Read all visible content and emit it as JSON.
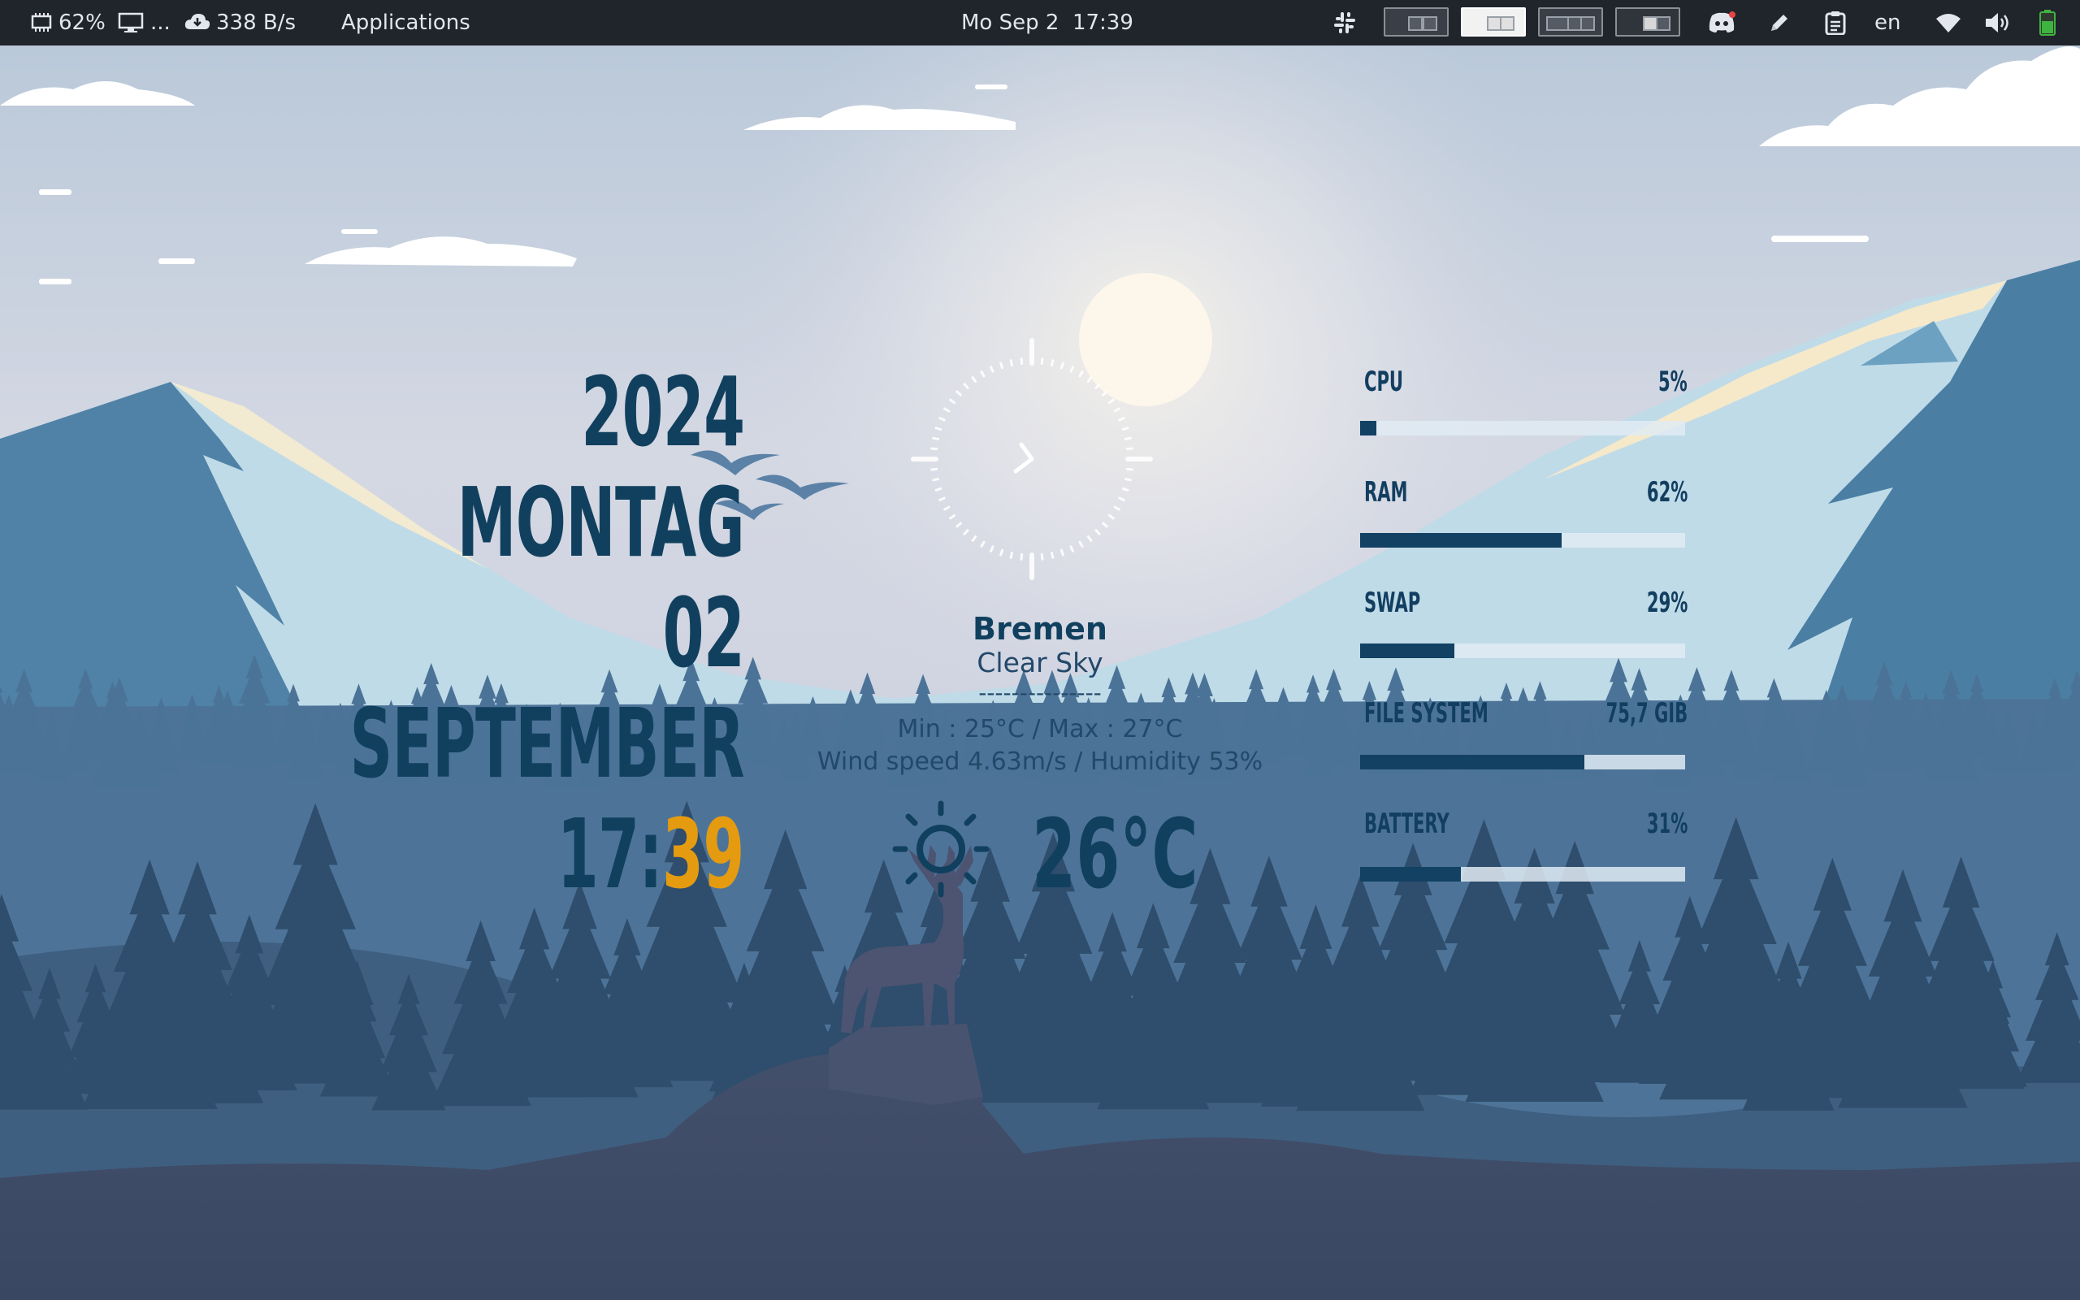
{
  "topbar": {
    "cpu_usage": "62%",
    "display_label": "...",
    "network_speed": "338 B/s",
    "applications_label": "Applications",
    "clock": "Mo Sep 2  17:39",
    "keyboard_layout": "en"
  },
  "clock_widget": {
    "year": "2024",
    "weekday": "MONTAG",
    "day": "02",
    "month": "SEPTEMBER",
    "hour": "17:",
    "minute": "39"
  },
  "weather": {
    "city": "Bremen",
    "condition": "Clear Sky",
    "separator": "---------------",
    "min_max": "Min : 25°C / Max : 27°C",
    "wind_humidity": "Wind speed 4.63m/s / Humidity 53%",
    "temperature": "26°C",
    "icon": "sun-icon"
  },
  "system": [
    {
      "label": "CPU",
      "value": "5%",
      "level": 0.05
    },
    {
      "label": "RAM",
      "value": "62%",
      "level": 0.62
    },
    {
      "label": "SWAP",
      "value": "29%",
      "level": 0.29
    },
    {
      "label": "FILE SYSTEM",
      "value": "75,7 GIB",
      "level": 0.69
    },
    {
      "label": "BATTERY",
      "value": "31%",
      "level": 0.31
    }
  ],
  "colors": {
    "accent": "#e59b10",
    "text_dark_blue": "#11405f",
    "topbar_bg": "#20242b",
    "battery_green": "#3fb33f"
  }
}
